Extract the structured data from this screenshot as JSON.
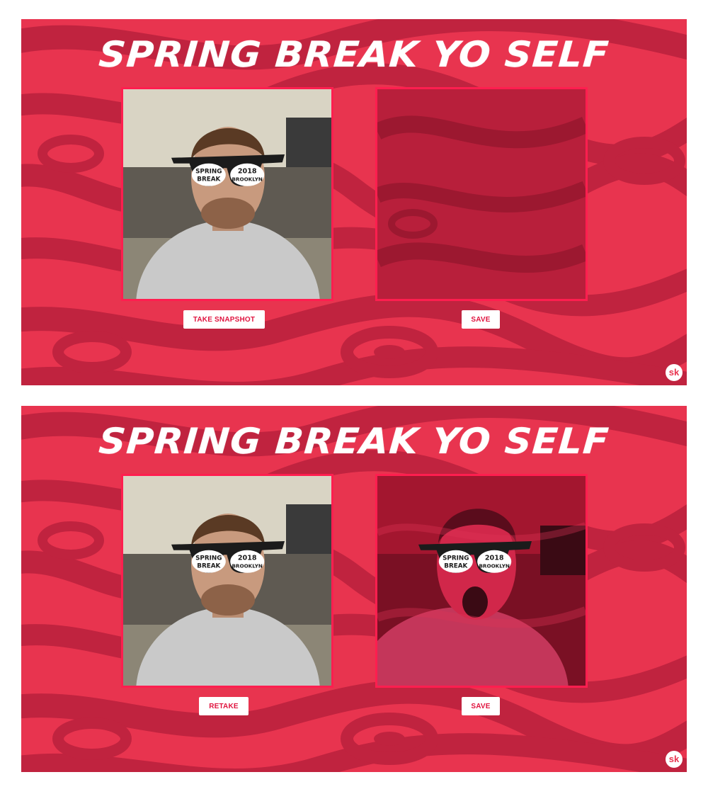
{
  "panels": [
    {
      "title": "SPRING BREAK YO SELF",
      "left_button": "TAKE SNAPSHOT",
      "right_button": "SAVE",
      "logo": "sk",
      "snapshot_taken": false
    },
    {
      "title": "SPRING BREAK YO SELF",
      "left_button": "RETAKE",
      "right_button": "SAVE",
      "logo": "sk",
      "snapshot_taken": true
    }
  ],
  "glasses_text": {
    "left_lens_top": "SPRING",
    "left_lens_bottom": "BREAK",
    "right_lens_top": "2018",
    "right_lens_bottom": "BROOKLYN"
  },
  "colors": {
    "background": "#e8344f",
    "swirl_dark": "#c0233f",
    "frame_border": "#ff1e4f",
    "button_text": "#e0143f"
  }
}
